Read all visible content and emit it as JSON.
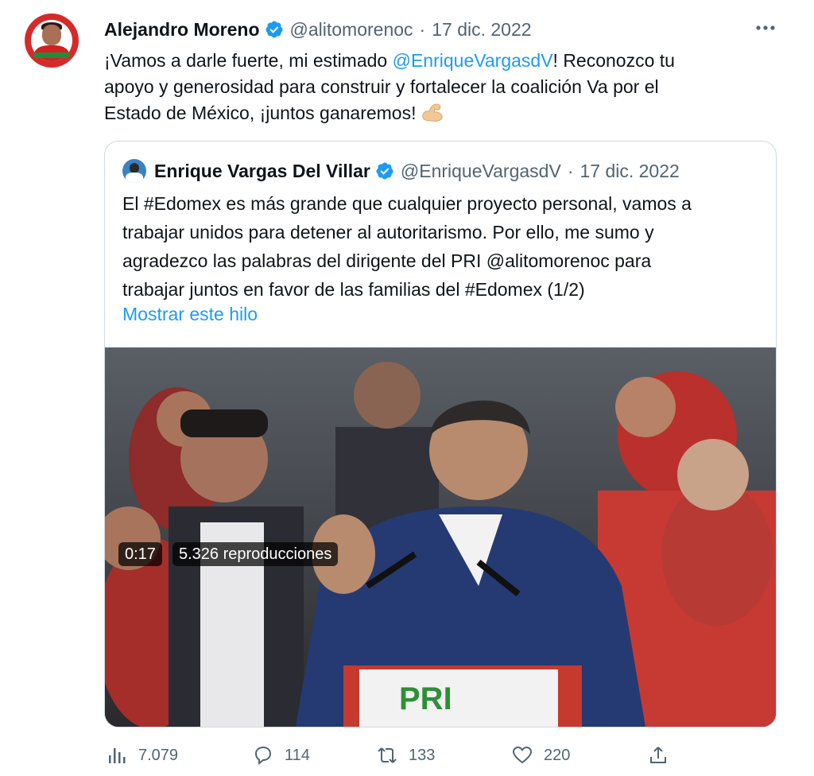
{
  "tweet": {
    "author_name": "Alejandro Moreno",
    "author_handle": "@alitomorenoc",
    "separator": "·",
    "date": "17 dic. 2022",
    "text_line1_a": "¡Vamos a darle fuerte, mi estimado ",
    "text_line1_mention": "@EnriqueVargasdV",
    "text_line1_b": "! Reconozco tu",
    "text_line2": "apoyo y generosidad para construir y fortalecer la coalición Va por el",
    "text_line3": "Estado de México, ¡juntos ganaremos!",
    "emoji": "flexed-biceps"
  },
  "quote": {
    "author_name": "Enrique Vargas Del Villar",
    "author_handle": "@EnriqueVargasdV",
    "separator": "·",
    "date": "17 dic. 2022",
    "lines": [
      "El #Edomex es más grande que cualquier proyecto personal, vamos a",
      "trabajar unidos para detener al autoritarismo. Por ello, me sumo y",
      "agradezco las palabras del dirigente del PRI @alitomorenoc para",
      "trabajar juntos en favor de las familias del #Edomex (1/2)"
    ],
    "show_thread": "Mostrar este hilo",
    "video": {
      "time": "0:17",
      "views": "5.326 reproducciones",
      "logo_text": "PRI"
    }
  },
  "actions": {
    "views": "7.079",
    "replies": "114",
    "retweets": "133",
    "likes": "220"
  },
  "colors": {
    "accent": "#1d9bf0",
    "secondary_text": "#536471",
    "border": "#cfd9de"
  }
}
